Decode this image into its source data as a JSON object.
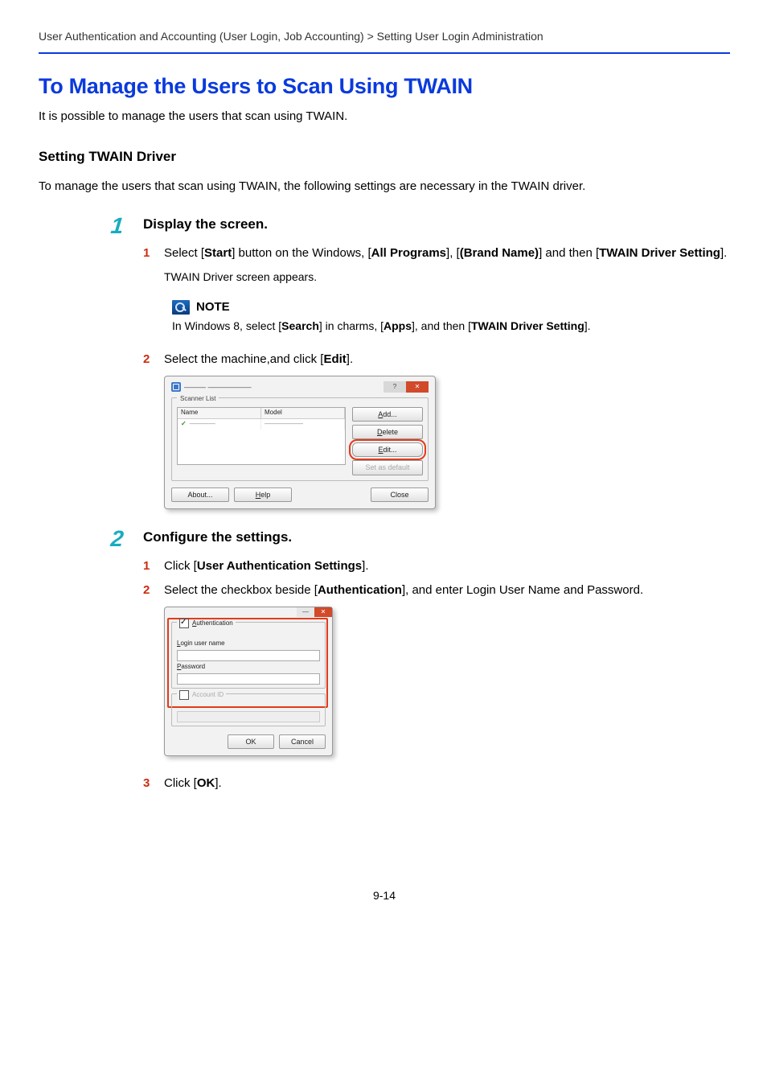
{
  "breadcrumb": "User Authentication and Accounting (User Login, Job Accounting) > Setting User Login Administration",
  "h1": "To Manage the Users to Scan Using TWAIN",
  "intro": "It is possible to manage the users that scan using TWAIN.",
  "sub_h": "Setting TWAIN Driver",
  "sub_intro": "To manage the users that scan using TWAIN, the following settings are necessary in the TWAIN driver.",
  "steps": {
    "s1": {
      "num": "1",
      "title": "Display the screen.",
      "a1_num": "1",
      "a1_pre": "Select [",
      "a1_b1": "Start",
      "a1_mid1": "] button on the Windows, [",
      "a1_b2": "All Programs",
      "a1_mid2": "], [",
      "a1_b3": "(Brand Name)",
      "a1_mid3": "] and then [",
      "a1_b4": "TWAIN Driver Setting",
      "a1_post": "].",
      "a1_follow": "TWAIN Driver screen appears.",
      "note_label": "NOTE",
      "note_pre": "In Windows 8, select [",
      "note_b1": "Search",
      "note_mid1": "] in charms, [",
      "note_b2": "Apps",
      "note_mid2": "], and then [",
      "note_b3": "TWAIN Driver Setting",
      "note_post": "].",
      "a2_num": "2",
      "a2_pre": "Select the machine,and click [",
      "a2_b1": "Edit",
      "a2_post": "]."
    },
    "s2": {
      "num": "2",
      "title": "Configure the settings.",
      "a1_num": "1",
      "a1_pre": "Click [",
      "a1_b1": "User Authentication Settings",
      "a1_post": "].",
      "a2_num": "2",
      "a2_pre": "Select the checkbox beside [",
      "a2_b1": "Authentication",
      "a2_post": "], and enter Login User Name and Password.",
      "a3_num": "3",
      "a3_pre": "Click [",
      "a3_b1": "OK",
      "a3_post": "]."
    }
  },
  "dlg1": {
    "title_blur": "———  ——————",
    "group": "Scanner List",
    "col1": "Name",
    "col2": "Model",
    "row1_c1": "————",
    "row1_c2": "——————",
    "btn_add": "Add...",
    "btn_delete": "Delete",
    "btn_edit": "Edit...",
    "btn_default": "Set as default",
    "btn_about": "About...",
    "btn_help": "Help",
    "btn_close": "Close"
  },
  "dlg2": {
    "grp_auth_leg_cb": "Authentication",
    "lbl_login_u": "L",
    "lbl_login": "ogin user name",
    "lbl_pass_u": "P",
    "lbl_pass": "assword",
    "grp_acct_leg": "Account ID",
    "btn_ok": "OK",
    "btn_cancel": "Cancel"
  },
  "page_num": "9-14"
}
